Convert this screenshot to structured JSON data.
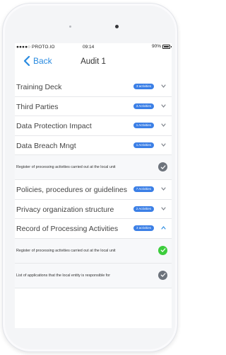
{
  "status_bar": {
    "carrier": "●●●●○ PROTO.IO",
    "time": "09:14",
    "battery": "90%"
  },
  "nav": {
    "back_label": "Back",
    "title": "Audit 1"
  },
  "colors": {
    "accent": "#2a8be0",
    "badge": "#3b7fe6",
    "check_grey": "#6d737c",
    "check_green": "#3ccd3c"
  },
  "rows": [
    {
      "type": "section",
      "label": "Training Deck",
      "badge": "3 activities",
      "chevron": "chevron-down-icon"
    },
    {
      "type": "section",
      "label": "Third Parties",
      "badge": "3 Activities",
      "chevron": "chevron-down-icon"
    },
    {
      "type": "section",
      "label": "Data Protection Impact",
      "badge": "1 Activities",
      "chevron": "chevron-down-icon"
    },
    {
      "type": "section",
      "label": "Data Breach Mngt",
      "badge": "1 Activities",
      "chevron": "chevron-down-icon"
    },
    {
      "type": "sub",
      "label": "Register of processing activities carried out at the local unit",
      "status": "grey"
    },
    {
      "type": "section",
      "label": "Policies, procedures or guidelines",
      "badge": "7 Activities",
      "chevron": "chevron-down-icon"
    },
    {
      "type": "section",
      "label": "Privacy organization structure",
      "badge": "2 Activities",
      "chevron": "chevron-down-icon"
    },
    {
      "type": "section",
      "label": "Record of Processing Activities",
      "badge": "3 activities",
      "chevron": "chevron-up-icon"
    },
    {
      "type": "sub",
      "label": "Register of processing activities carried out at the local unit",
      "status": "green"
    },
    {
      "type": "sub",
      "label": "List of applications that the local entity is responsible for",
      "status": "grey"
    }
  ]
}
